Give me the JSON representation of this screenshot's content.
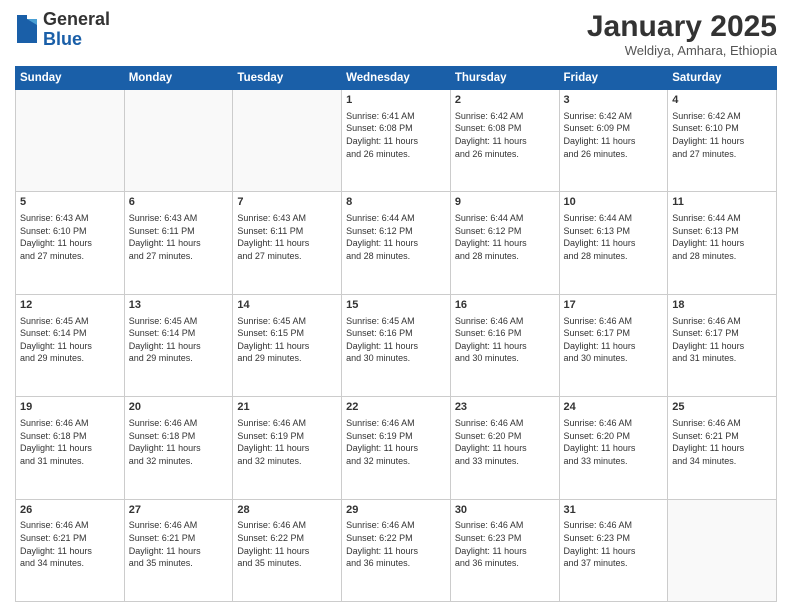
{
  "logo": {
    "general": "General",
    "blue": "Blue"
  },
  "header": {
    "month": "January 2025",
    "location": "Weldiya, Amhara, Ethiopia"
  },
  "weekdays": [
    "Sunday",
    "Monday",
    "Tuesday",
    "Wednesday",
    "Thursday",
    "Friday",
    "Saturday"
  ],
  "weeks": [
    [
      {
        "day": "",
        "info": ""
      },
      {
        "day": "",
        "info": ""
      },
      {
        "day": "",
        "info": ""
      },
      {
        "day": "1",
        "info": "Sunrise: 6:41 AM\nSunset: 6:08 PM\nDaylight: 11 hours\nand 26 minutes."
      },
      {
        "day": "2",
        "info": "Sunrise: 6:42 AM\nSunset: 6:08 PM\nDaylight: 11 hours\nand 26 minutes."
      },
      {
        "day": "3",
        "info": "Sunrise: 6:42 AM\nSunset: 6:09 PM\nDaylight: 11 hours\nand 26 minutes."
      },
      {
        "day": "4",
        "info": "Sunrise: 6:42 AM\nSunset: 6:10 PM\nDaylight: 11 hours\nand 27 minutes."
      }
    ],
    [
      {
        "day": "5",
        "info": "Sunrise: 6:43 AM\nSunset: 6:10 PM\nDaylight: 11 hours\nand 27 minutes."
      },
      {
        "day": "6",
        "info": "Sunrise: 6:43 AM\nSunset: 6:11 PM\nDaylight: 11 hours\nand 27 minutes."
      },
      {
        "day": "7",
        "info": "Sunrise: 6:43 AM\nSunset: 6:11 PM\nDaylight: 11 hours\nand 27 minutes."
      },
      {
        "day": "8",
        "info": "Sunrise: 6:44 AM\nSunset: 6:12 PM\nDaylight: 11 hours\nand 28 minutes."
      },
      {
        "day": "9",
        "info": "Sunrise: 6:44 AM\nSunset: 6:12 PM\nDaylight: 11 hours\nand 28 minutes."
      },
      {
        "day": "10",
        "info": "Sunrise: 6:44 AM\nSunset: 6:13 PM\nDaylight: 11 hours\nand 28 minutes."
      },
      {
        "day": "11",
        "info": "Sunrise: 6:44 AM\nSunset: 6:13 PM\nDaylight: 11 hours\nand 28 minutes."
      }
    ],
    [
      {
        "day": "12",
        "info": "Sunrise: 6:45 AM\nSunset: 6:14 PM\nDaylight: 11 hours\nand 29 minutes."
      },
      {
        "day": "13",
        "info": "Sunrise: 6:45 AM\nSunset: 6:14 PM\nDaylight: 11 hours\nand 29 minutes."
      },
      {
        "day": "14",
        "info": "Sunrise: 6:45 AM\nSunset: 6:15 PM\nDaylight: 11 hours\nand 29 minutes."
      },
      {
        "day": "15",
        "info": "Sunrise: 6:45 AM\nSunset: 6:16 PM\nDaylight: 11 hours\nand 30 minutes."
      },
      {
        "day": "16",
        "info": "Sunrise: 6:46 AM\nSunset: 6:16 PM\nDaylight: 11 hours\nand 30 minutes."
      },
      {
        "day": "17",
        "info": "Sunrise: 6:46 AM\nSunset: 6:17 PM\nDaylight: 11 hours\nand 30 minutes."
      },
      {
        "day": "18",
        "info": "Sunrise: 6:46 AM\nSunset: 6:17 PM\nDaylight: 11 hours\nand 31 minutes."
      }
    ],
    [
      {
        "day": "19",
        "info": "Sunrise: 6:46 AM\nSunset: 6:18 PM\nDaylight: 11 hours\nand 31 minutes."
      },
      {
        "day": "20",
        "info": "Sunrise: 6:46 AM\nSunset: 6:18 PM\nDaylight: 11 hours\nand 32 minutes."
      },
      {
        "day": "21",
        "info": "Sunrise: 6:46 AM\nSunset: 6:19 PM\nDaylight: 11 hours\nand 32 minutes."
      },
      {
        "day": "22",
        "info": "Sunrise: 6:46 AM\nSunset: 6:19 PM\nDaylight: 11 hours\nand 32 minutes."
      },
      {
        "day": "23",
        "info": "Sunrise: 6:46 AM\nSunset: 6:20 PM\nDaylight: 11 hours\nand 33 minutes."
      },
      {
        "day": "24",
        "info": "Sunrise: 6:46 AM\nSunset: 6:20 PM\nDaylight: 11 hours\nand 33 minutes."
      },
      {
        "day": "25",
        "info": "Sunrise: 6:46 AM\nSunset: 6:21 PM\nDaylight: 11 hours\nand 34 minutes."
      }
    ],
    [
      {
        "day": "26",
        "info": "Sunrise: 6:46 AM\nSunset: 6:21 PM\nDaylight: 11 hours\nand 34 minutes."
      },
      {
        "day": "27",
        "info": "Sunrise: 6:46 AM\nSunset: 6:21 PM\nDaylight: 11 hours\nand 35 minutes."
      },
      {
        "day": "28",
        "info": "Sunrise: 6:46 AM\nSunset: 6:22 PM\nDaylight: 11 hours\nand 35 minutes."
      },
      {
        "day": "29",
        "info": "Sunrise: 6:46 AM\nSunset: 6:22 PM\nDaylight: 11 hours\nand 36 minutes."
      },
      {
        "day": "30",
        "info": "Sunrise: 6:46 AM\nSunset: 6:23 PM\nDaylight: 11 hours\nand 36 minutes."
      },
      {
        "day": "31",
        "info": "Sunrise: 6:46 AM\nSunset: 6:23 PM\nDaylight: 11 hours\nand 37 minutes."
      },
      {
        "day": "",
        "info": ""
      }
    ]
  ]
}
